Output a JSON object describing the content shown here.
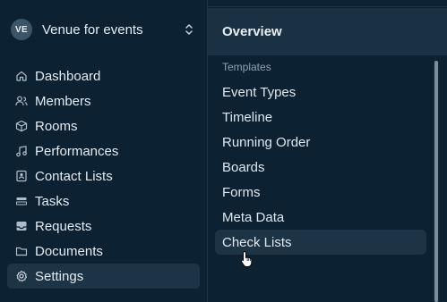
{
  "org": {
    "initials": "VE",
    "name": "Venue for events"
  },
  "nav": {
    "items": [
      {
        "label": "Dashboard",
        "icon": "home-icon"
      },
      {
        "label": "Members",
        "icon": "users-icon"
      },
      {
        "label": "Rooms",
        "icon": "cube-icon"
      },
      {
        "label": "Performances",
        "icon": "music-note-icon"
      },
      {
        "label": "Contact Lists",
        "icon": "contact-card-icon"
      },
      {
        "label": "Tasks",
        "icon": "tasks-icon"
      },
      {
        "label": "Requests",
        "icon": "inbox-icon"
      },
      {
        "label": "Documents",
        "icon": "folder-icon"
      },
      {
        "label": "Settings",
        "icon": "gear-icon",
        "active": true
      }
    ]
  },
  "panel": {
    "title": "Overview",
    "section_label": "Templates",
    "items": [
      {
        "label": "Event Types"
      },
      {
        "label": "Timeline"
      },
      {
        "label": "Running Order"
      },
      {
        "label": "Boards"
      },
      {
        "label": "Forms"
      },
      {
        "label": "Meta Data"
      },
      {
        "label": "Check Lists",
        "hovered": true
      }
    ]
  },
  "colors": {
    "background": "#0c2233",
    "active_bg": "#1d3446",
    "header_bg": "#1a3143",
    "muted_text": "#8ea2b2"
  }
}
